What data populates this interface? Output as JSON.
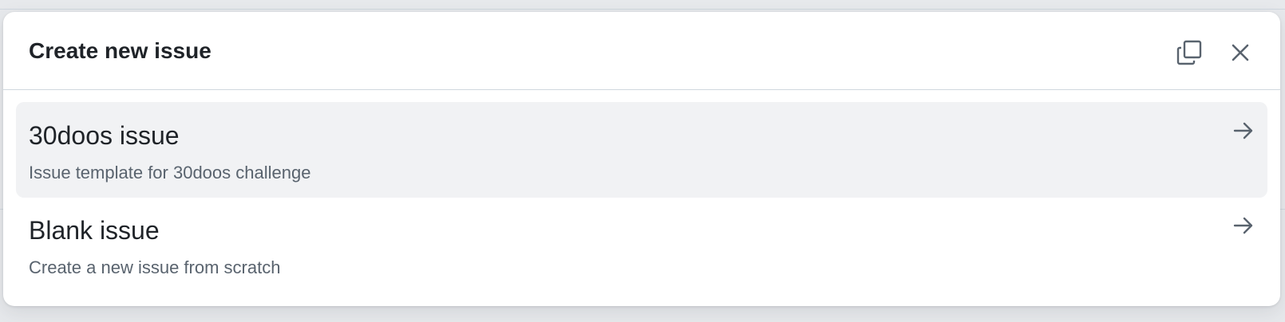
{
  "dialog": {
    "title": "Create new issue",
    "copy_icon": "copy-icon",
    "close_icon": "close-icon"
  },
  "templates": [
    {
      "title": "30doos issue",
      "description": "Issue template for 30doos challenge",
      "icon": "arrow-right-icon"
    },
    {
      "title": "Blank issue",
      "description": "Create a new issue from scratch",
      "icon": "arrow-right-icon"
    }
  ],
  "colors": {
    "text_primary": "#1f2328",
    "text_muted": "#59636e",
    "hover_bg": "#f1f2f4",
    "icon": "#59636e"
  }
}
